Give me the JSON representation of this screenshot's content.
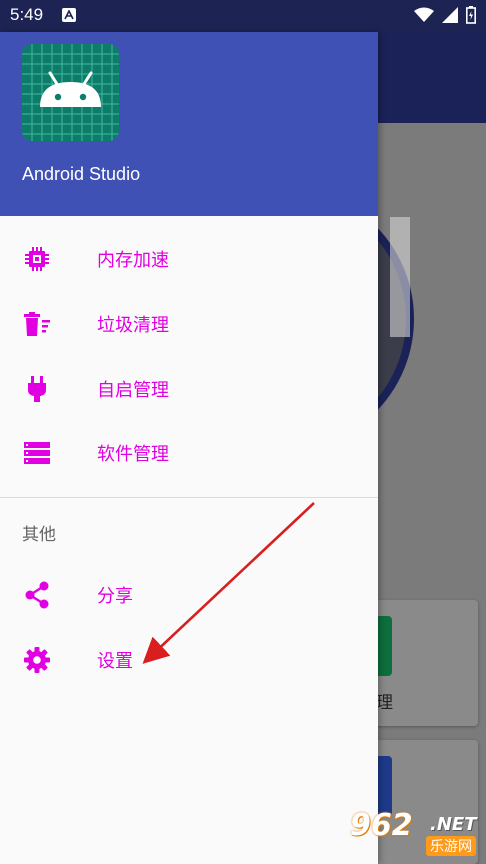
{
  "status_bar": {
    "time": "5:49",
    "icons": [
      "notification-a-icon",
      "wifi-icon",
      "signal-icon",
      "battery-icon"
    ]
  },
  "drawer": {
    "app_name": "Android Studio",
    "header_color": "#3f51b5",
    "items": [
      {
        "label": "内存加速",
        "icon": "cpu-chip-icon"
      },
      {
        "label": "垃圾清理",
        "icon": "trash-clean-icon"
      },
      {
        "label": "自启管理",
        "icon": "power-plug-icon"
      },
      {
        "label": "软件管理",
        "icon": "list-manage-icon"
      }
    ],
    "section_title": "其他",
    "other_items": [
      {
        "label": "分享",
        "icon": "share-icon"
      },
      {
        "label": "设置",
        "icon": "gear-icon"
      }
    ],
    "accent_color": "#e100e1"
  },
  "background_app": {
    "card_label": "理"
  },
  "watermark": {
    "number": "962",
    "net": ".NET",
    "cn": "乐游网"
  }
}
